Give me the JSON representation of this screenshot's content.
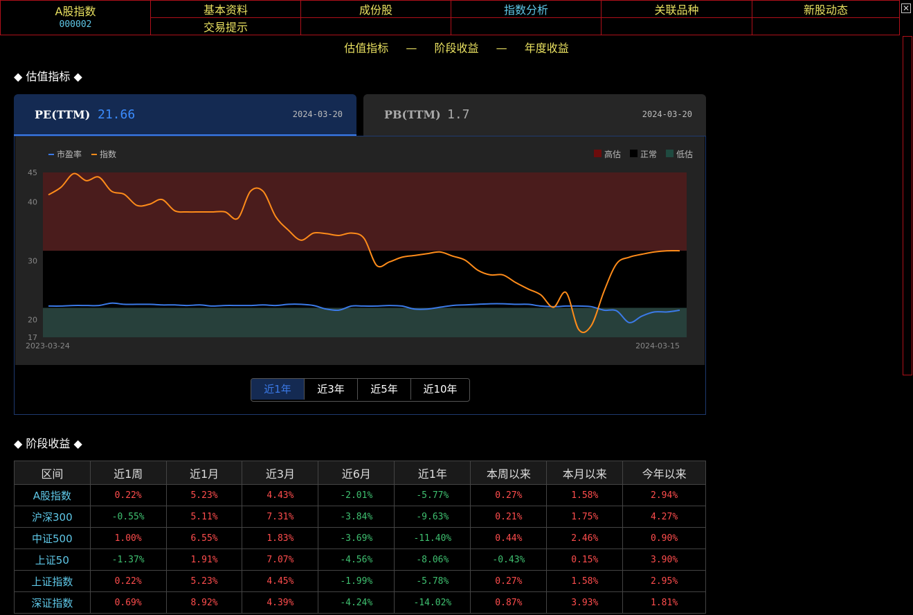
{
  "header": {
    "index_name": "A股指数",
    "index_code": "000002",
    "nav_row1": [
      "基本资料",
      "成份股",
      "指数分析",
      "关联品种",
      "新股动态"
    ],
    "nav_row2": [
      "交易提示",
      "",
      "",
      "",
      ""
    ],
    "active_nav": "指数分析",
    "close_glyph": "✕"
  },
  "subnav": {
    "items": [
      "估值指标",
      "阶段收益",
      "年度收益"
    ],
    "sep": "—"
  },
  "valuation": {
    "section_title": "◆  估值指标  ◆",
    "pe": {
      "label": "PE(TTM)",
      "value": "21.66",
      "date": "2024-03-20"
    },
    "pb": {
      "label": "PB(TTM)",
      "value": "1.7",
      "date": "2024-03-20"
    }
  },
  "chart_data": {
    "type": "line",
    "legend": [
      "市盈率",
      "指数"
    ],
    "band_legend": [
      "高估",
      "正常",
      "低估"
    ],
    "x_start": "2023-03-24",
    "x_end": "2024-03-15",
    "yticks": [
      45,
      40,
      30,
      20,
      17
    ],
    "ylim": [
      17,
      45
    ],
    "band_high": [
      31.7,
      45
    ],
    "band_normal": [
      22,
      31.7
    ],
    "band_low": [
      17,
      22
    ],
    "series": [
      {
        "name": "市盈率",
        "color": "#3b7ae8",
        "values": [
          22.3,
          22.3,
          22.4,
          22.4,
          22.4,
          22.8,
          22.6,
          22.6,
          22.6,
          22.5,
          22.5,
          22.4,
          22.5,
          22.3,
          22.4,
          22.4,
          22.4,
          22.5,
          22.4,
          22.6,
          22.6,
          22.4,
          21.8,
          21.6,
          22.3,
          22.3,
          22.3,
          22.4,
          22.3,
          21.8,
          21.8,
          22.1,
          22.4,
          22.5,
          22.6,
          22.7,
          22.7,
          22.6,
          22.6,
          22.3,
          22.2,
          22.3,
          22.3,
          22.2,
          21.6,
          21.5,
          19.5,
          20.6,
          21.3,
          21.3,
          21.6
        ]
      },
      {
        "name": "指数",
        "color": "#ff8c1a",
        "values": [
          41.2,
          42.5,
          44.8,
          43.6,
          44.2,
          41.8,
          41.3,
          39.4,
          39.6,
          40.4,
          38.5,
          38.3,
          38.3,
          38.3,
          38.3,
          37.2,
          41.8,
          41.8,
          37.5,
          35.2,
          33.5,
          34.7,
          34.6,
          34.3,
          34.7,
          33.8,
          29.2,
          29.8,
          30.6,
          30.9,
          31.2,
          31.5,
          30.8,
          30.1,
          28.4,
          27.6,
          27.6,
          26.3,
          25.2,
          24.2,
          22.1,
          24.6,
          18.3,
          19.0,
          24.8,
          29.5,
          30.6,
          31.1,
          31.5,
          31.7,
          31.7
        ]
      }
    ]
  },
  "periods": {
    "items": [
      "近1年",
      "近3年",
      "近5年",
      "近10年"
    ],
    "active": 0
  },
  "returns": {
    "section_title": "◆  阶段收益  ◆",
    "headers": [
      "区间",
      "近1周",
      "近1月",
      "近3月",
      "近6月",
      "近1年",
      "本周以来",
      "本月以来",
      "今年以来"
    ],
    "rows": [
      [
        "A股指数",
        "0.22%",
        "5.23%",
        "4.43%",
        "-2.01%",
        "-5.77%",
        "0.27%",
        "1.58%",
        "2.94%"
      ],
      [
        "沪深300",
        "-0.55%",
        "5.11%",
        "7.31%",
        "-3.84%",
        "-9.63%",
        "0.21%",
        "1.75%",
        "4.27%"
      ],
      [
        "中证500",
        "1.00%",
        "6.55%",
        "1.83%",
        "-3.69%",
        "-11.40%",
        "0.44%",
        "2.46%",
        "0.90%"
      ],
      [
        "上证50",
        "-1.37%",
        "1.91%",
        "7.07%",
        "-4.56%",
        "-8.06%",
        "-0.43%",
        "0.15%",
        "3.90%"
      ],
      [
        "上证指数",
        "0.22%",
        "5.23%",
        "4.45%",
        "-1.99%",
        "-5.78%",
        "0.27%",
        "1.58%",
        "2.95%"
      ],
      [
        "深证指数",
        "0.69%",
        "8.92%",
        "4.39%",
        "-4.24%",
        "-14.02%",
        "0.87%",
        "3.93%",
        "1.81%"
      ]
    ]
  }
}
